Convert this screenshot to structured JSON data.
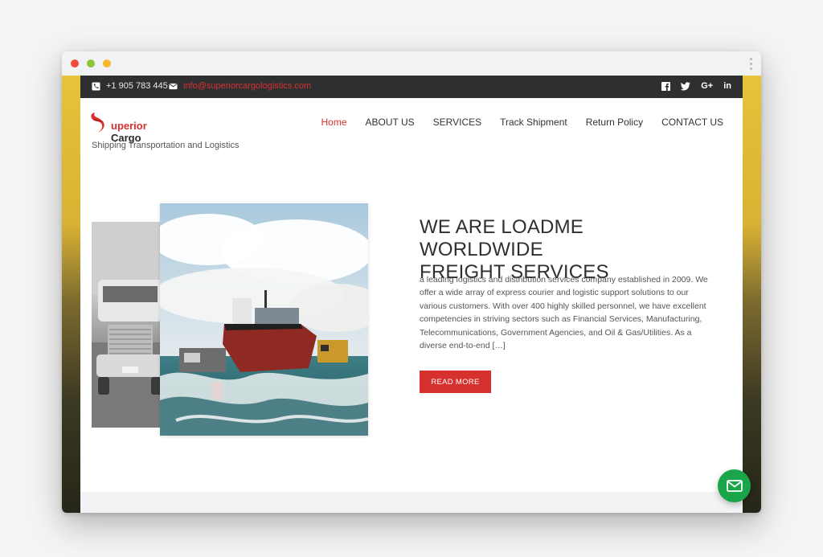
{
  "topbar": {
    "phone": "+1 905 783 445",
    "email": "info@superiorcargologistics.com",
    "phone_icon": "phone-icon",
    "email_icon": "envelope-icon",
    "social": [
      {
        "name": "facebook-icon",
        "label": "f"
      },
      {
        "name": "twitter-icon",
        "label": ""
      },
      {
        "name": "google-plus-icon",
        "label": "G+"
      },
      {
        "name": "linkedin-icon",
        "label": "in"
      }
    ]
  },
  "brand": {
    "logo_r": "uperior",
    "logo_d": "Cargo",
    "tagline": "Shipping Transportation and Logistics"
  },
  "nav": {
    "items": [
      "Home",
      "ABOUT US",
      "SERVICES",
      "Track Shipment",
      "Return Policy",
      "CONTACT US"
    ],
    "active": "Home"
  },
  "hero": {
    "title_line1": "WE ARE LOADME WORLDWIDE",
    "title_line2": "FREIGHT SERVICES",
    "body": "a leading logistics and distribution services company established in 2009. We offer a wide array of express courier and logistic support solutions to our various customers. With over 400 highly skilled personnel, we have excellent competencies in striving sectors such as Financial Services, Manufacturing, Telecommunications, Government Agencies, and Oil & Gas/Utilities. As a diverse end-to-end […]",
    "button": "READ MORE"
  },
  "colors": {
    "accent": "#d7312f",
    "topbar_bg": "#2e2f31",
    "fab": "#1aa54b"
  },
  "fab_icon": "mail-icon"
}
